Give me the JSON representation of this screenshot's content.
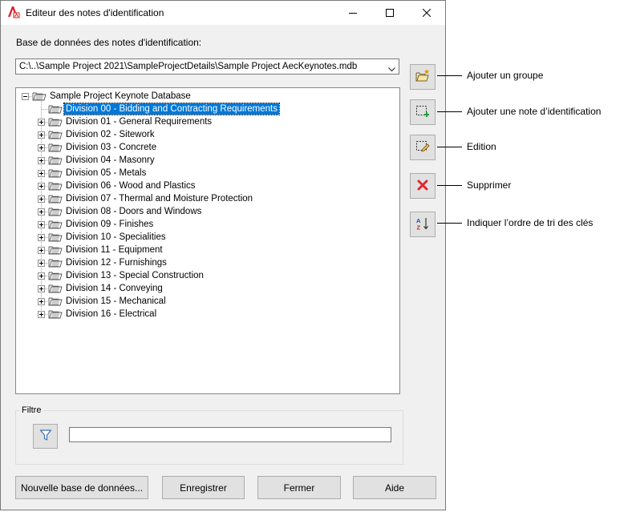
{
  "window": {
    "title": "Editeur des notes d'identification"
  },
  "database": {
    "label": "Base de données des notes d'identification:",
    "selected": "C:\\..\\Sample Project 2021\\SampleProjectDetails\\Sample Project AecKeynotes.mdb"
  },
  "tree": {
    "root": "Sample Project Keynote Database",
    "items": [
      "Division 00 - Bidding and Contracting Requirements",
      "Division 01 - General Requirements",
      "Division 02 - Sitework",
      "Division 03 - Concrete",
      "Division 04 - Masonry",
      "Division 05 - Metals",
      "Division 06 - Wood and Plastics",
      "Division 07 - Thermal and Moisture Protection",
      "Division 08 - Doors and Windows",
      "Division 09 - Finishes",
      "Division 10 - Specialities",
      "Division 11 - Equipment",
      "Division 12 - Furnishings",
      "Division 13 - Special Construction",
      "Division 14 - Conveying",
      "Division 15 - Mechanical",
      "Division 16 - Electrical"
    ]
  },
  "side_buttons": [
    {
      "icon": "add-group-icon",
      "callout": "Ajouter un groupe"
    },
    {
      "icon": "add-keynote-icon",
      "callout": "Ajouter une note d’identification"
    },
    {
      "icon": "edit-icon",
      "callout": "Edition"
    },
    {
      "icon": "delete-icon",
      "callout": "Supprimer"
    },
    {
      "icon": "sort-icon",
      "callout": "Indiquer l’ordre de tri des clés"
    }
  ],
  "filter": {
    "label": "Filtre",
    "value": ""
  },
  "buttons": {
    "new_db": "Nouvelle base de données...",
    "save": "Enregistrer",
    "close": "Fermer",
    "help": "Aide"
  },
  "colors": {
    "selection": "#0078d7",
    "delete": "#e0282e"
  }
}
